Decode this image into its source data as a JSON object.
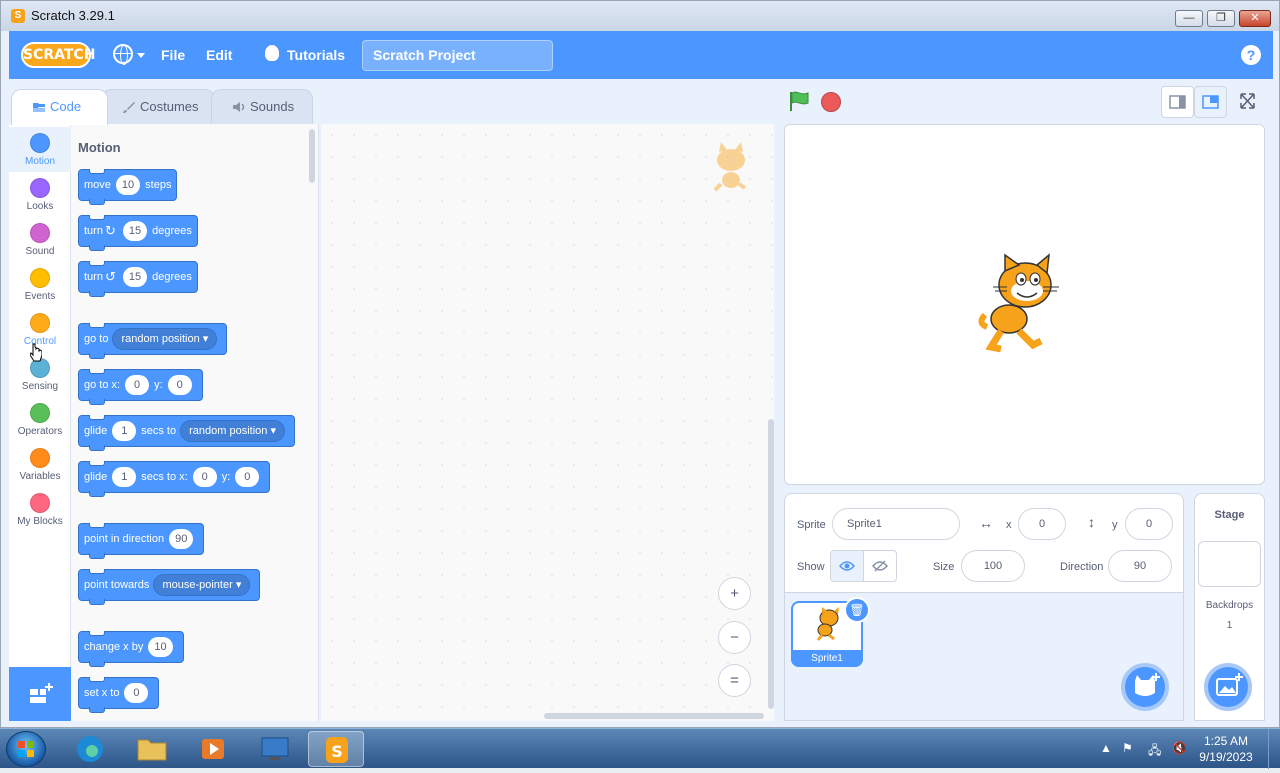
{
  "window": {
    "title": "Scratch 3.29.1",
    "min": "—",
    "max": "❐",
    "close": "✕"
  },
  "menubar": {
    "logo": "SCRATCH",
    "file": "File",
    "edit": "Edit",
    "tutorials": "Tutorials",
    "project_title": "Scratch Project",
    "help": "?"
  },
  "tabs": {
    "code": "Code",
    "costumes": "Costumes",
    "sounds": "Sounds"
  },
  "categories": [
    {
      "label": "Motion",
      "color": "#4c97ff"
    },
    {
      "label": "Looks",
      "color": "#9966ff"
    },
    {
      "label": "Sound",
      "color": "#cf63cf"
    },
    {
      "label": "Events",
      "color": "#ffbf00"
    },
    {
      "label": "Control",
      "color": "#ffab19"
    },
    {
      "label": "Sensing",
      "color": "#5cb1d6"
    },
    {
      "label": "Operators",
      "color": "#59c059"
    },
    {
      "label": "Variables",
      "color": "#ff8c1a"
    },
    {
      "label": "My Blocks",
      "color": "#ff6680"
    }
  ],
  "palette": {
    "header": "Motion",
    "move": {
      "t1": "move",
      "v": "10",
      "t2": "steps"
    },
    "turn_cw": {
      "t1": "turn",
      "icon": "↻",
      "v": "15",
      "t2": "degrees"
    },
    "turn_ccw": {
      "t1": "turn",
      "icon": "↺",
      "v": "15",
      "t2": "degrees"
    },
    "goto": {
      "t1": "go to",
      "dd": "random position"
    },
    "goto_xy": {
      "t1": "go to x:",
      "x": "0",
      "t2": "y:",
      "y": "0"
    },
    "glide_to": {
      "t1": "glide",
      "v": "1",
      "t2": "secs to",
      "dd": "random position"
    },
    "glide_xy": {
      "t1": "glide",
      "v": "1",
      "t2": "secs to x:",
      "x": "0",
      "t3": "y:",
      "y": "0"
    },
    "point_dir": {
      "t1": "point in direction",
      "v": "90"
    },
    "point_towards": {
      "t1": "point towards",
      "dd": "mouse-pointer"
    },
    "change_x": {
      "t1": "change x by",
      "v": "10"
    },
    "set_x": {
      "t1": "set x to",
      "v": "0"
    }
  },
  "zoom": {
    "in": "+",
    "out": "−",
    "reset": "="
  },
  "sprite_info": {
    "sprite_label": "Sprite",
    "sprite_name": "Sprite1",
    "x_label": "x",
    "x": "0",
    "y_label": "y",
    "y": "0",
    "show_label": "Show",
    "size_label": "Size",
    "size": "100",
    "direction_label": "Direction",
    "direction": "90"
  },
  "sprites": [
    {
      "name": "Sprite1"
    }
  ],
  "stage_panel": {
    "title": "Stage",
    "backdrops_label": "Backdrops",
    "backdrops_count": "1"
  },
  "taskbar": {
    "time": "1:25 AM",
    "date": "9/19/2023"
  },
  "colors": {
    "accent": "#4c97ff",
    "menubar": "#4c97ff",
    "motion": "#4c97ff"
  }
}
